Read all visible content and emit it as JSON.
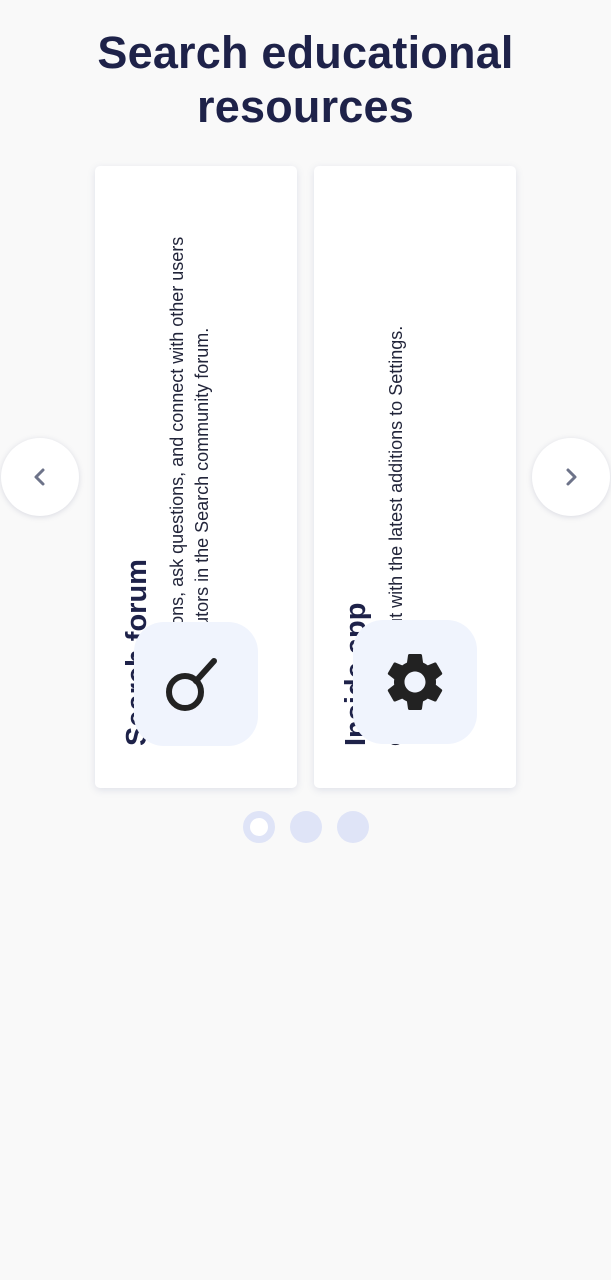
{
  "header": {
    "title": "Search educational resources"
  },
  "cards": [
    {
      "heading": "Search forum",
      "description": "Share suggestions, ask questions, and connect with other users and top contributors in the Search community forum.",
      "icon": "search-icon"
    },
    {
      "heading": "Inside app",
      "description": "Get the most out with the latest additions to Settings.",
      "icon": "gear-icon"
    }
  ],
  "carousel": {
    "prev_icon": "chevron-left-icon",
    "next_icon": "chevron-right-icon",
    "page_count": 3,
    "active_page": 1
  },
  "colors": {
    "background": "#f9f9f9",
    "title": "#1e2249",
    "icon_tile": "#f0f4fd",
    "dot": "#dfe4f7",
    "icon": "#222222",
    "chevron": "#6d7389"
  }
}
